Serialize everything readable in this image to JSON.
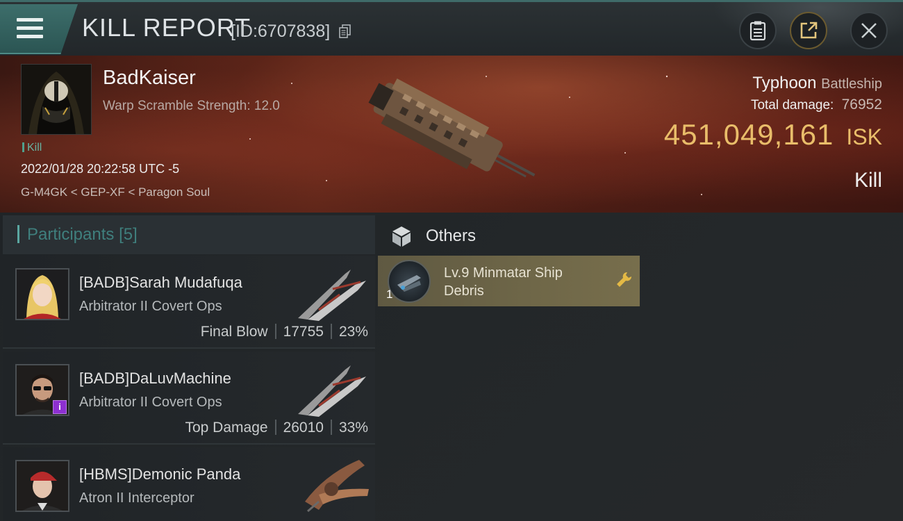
{
  "header": {
    "title": "KILL REPORT",
    "report_id": "[ID:6707838]"
  },
  "victim": {
    "name": "BadKaiser",
    "stat": "Warp Scramble Strength: 12.0",
    "tag": "Kill",
    "timestamp": "2022/01/28 20:22:58 UTC -5",
    "location": "G-M4GK < GEP-XF < Paragon Soul",
    "ship_name": "Typhoon",
    "ship_class": "Battleship",
    "total_damage_label": "Total damage:",
    "total_damage": "76952",
    "isk_value": "451,049,161",
    "isk_unit": "ISK",
    "result": "Kill"
  },
  "participants": {
    "label": "Participants",
    "count": "[5]",
    "rows": [
      {
        "name": "[BADB]Sarah Mudafuqa",
        "ship": "Arbitrator II Covert Ops",
        "role": "Final Blow",
        "damage": "17755",
        "percent": "23%"
      },
      {
        "name": "[BADB]DaLuvMachine",
        "ship": "Arbitrator II Covert Ops",
        "role": "Top Damage",
        "damage": "26010",
        "percent": "33%",
        "badge": "i"
      },
      {
        "name": "[HBMS]Demonic Panda",
        "ship": "Atron II Interceptor"
      }
    ]
  },
  "others": {
    "label": "Others",
    "items": [
      {
        "qty": "1",
        "name": "Lv.9 Minmatar Ship Debris",
        "icon": "wrench-icon"
      }
    ]
  },
  "colors": {
    "accent_teal": "#3d6e6b",
    "isk_gold": "#e9bd6a",
    "item_gold": "#6f6748"
  }
}
